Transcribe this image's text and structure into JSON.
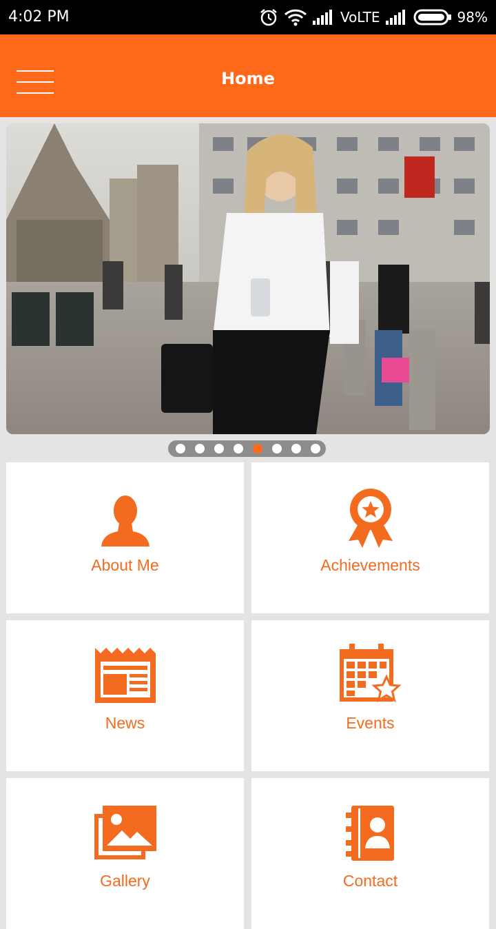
{
  "status_bar": {
    "time": "4:02 PM",
    "network": "VoLTE",
    "battery": "98%"
  },
  "app_bar": {
    "title": "Home",
    "menu_icon": "hamburger-menu-icon"
  },
  "carousel": {
    "slide_count": 8,
    "active_index": 4
  },
  "grid": {
    "items": [
      {
        "label": "About Me",
        "icon": "person-icon"
      },
      {
        "label": "Achievements",
        "icon": "award-badge-icon"
      },
      {
        "label": "News",
        "icon": "newspaper-icon"
      },
      {
        "label": "Events",
        "icon": "calendar-star-icon"
      },
      {
        "label": "Gallery",
        "icon": "gallery-icon"
      },
      {
        "label": "Contact",
        "icon": "contact-book-icon"
      }
    ]
  },
  "colors": {
    "accent": "#fe6a1a",
    "icon": "#f26b1f",
    "background": "#e4e4e4"
  }
}
